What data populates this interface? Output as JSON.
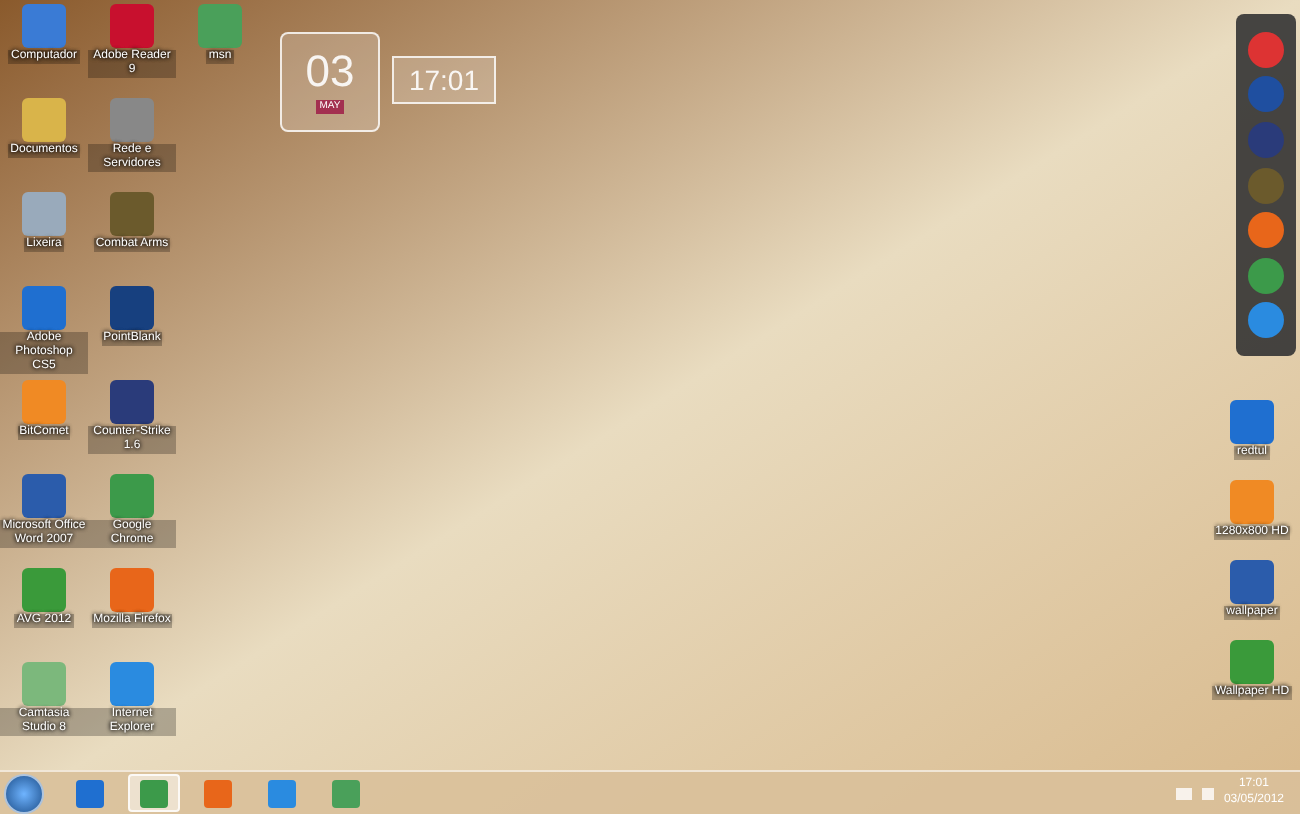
{
  "desktop_icons_left": [
    {
      "label": "Computador"
    },
    {
      "label": "Documentos"
    },
    {
      "label": "Lixeira"
    },
    {
      "label": "Adobe Photoshop CS5"
    },
    {
      "label": "BitComet"
    },
    {
      "label": "Microsoft Office Word 2007"
    },
    {
      "label": "AVG 2012"
    },
    {
      "label": "Camtasia Studio 8"
    },
    {
      "label": "Adobe Reader 9"
    },
    {
      "label": "Rede e Servidores"
    },
    {
      "label": "Combat Arms"
    },
    {
      "label": "PointBlank"
    },
    {
      "label": "Counter-Strike 1.6"
    },
    {
      "label": "Google Chrome"
    },
    {
      "label": "Mozilla Firefox"
    },
    {
      "label": "Internet Explorer"
    },
    {
      "label": "msn"
    }
  ],
  "clock_widget": {
    "day": "03",
    "month": "MAY",
    "time": "17:01"
  },
  "desktop_icons_right": [
    {
      "label": "redtul"
    },
    {
      "label": "1280x800 HD"
    },
    {
      "label": "wallpaper"
    },
    {
      "label": "Wallpaper HD"
    }
  ],
  "taskbar": {
    "items": [
      {
        "selected": false
      },
      {
        "selected": true
      },
      {
        "selected": false
      },
      {
        "selected": false
      },
      {
        "selected": false
      }
    ],
    "time": "17:01",
    "date": "03/05/2012"
  }
}
